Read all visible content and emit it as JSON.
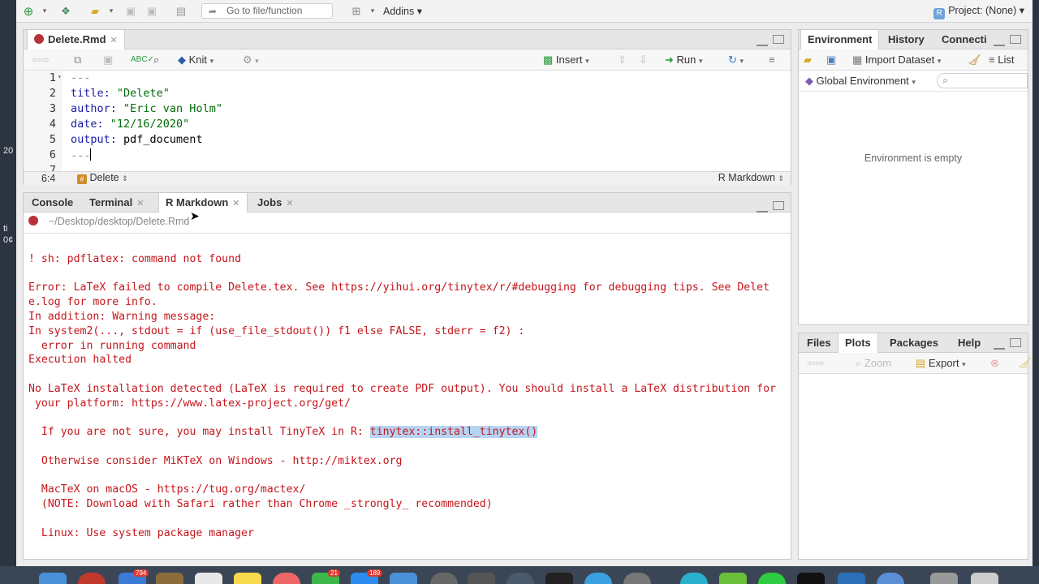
{
  "desktop": {
    "left_labels": [
      "20",
      "ti",
      "0¢"
    ],
    "dock_badges": [
      "794",
      "21",
      "189"
    ]
  },
  "toolbar": {
    "goto_placeholder": "Go to file/function",
    "addins_label": "Addins",
    "project_label": "Project: (None)"
  },
  "source": {
    "tab_label": "Delete.Rmd",
    "knit_label": "Knit",
    "insert_label": "Insert",
    "run_label": "Run",
    "lines": [
      {
        "n": "1",
        "text": "---"
      },
      {
        "n": "2",
        "key": "title:",
        "val": " \"Delete\""
      },
      {
        "n": "3",
        "key": "author:",
        "val": " \"Eric van Holm\""
      },
      {
        "n": "4",
        "key": "date:",
        "val": " \"12/16/2020\""
      },
      {
        "n": "5",
        "key": "output:",
        "plain": " pdf_document"
      },
      {
        "n": "6",
        "text": "---"
      },
      {
        "n": "7",
        "text": ""
      }
    ],
    "cursor_pos": "6:4",
    "chunk_label": "Delete",
    "file_type": "R Markdown"
  },
  "console_pane": {
    "tabs": [
      "Console",
      "Terminal",
      "R Markdown",
      "Jobs"
    ],
    "active_tab": "R Markdown",
    "path": "~/Desktop/desktop/Delete.Rmd",
    "output": [
      "! sh: pdflatex: command not found",
      "",
      "Error: LaTeX failed to compile Delete.tex. See https://yihui.org/tinytex/r/#debugging for debugging tips. See Delet",
      "e.log for more info.",
      "In addition: Warning message:",
      "In system2(..., stdout = if (use_file_stdout()) f1 else FALSE, stderr = f2) :",
      "  error in running command",
      "Execution halted",
      "",
      "No LaTeX installation detected (LaTeX is required to create PDF output). You should install a LaTeX distribution for",
      " your platform: https://www.latex-project.org/get/",
      "",
      "  If you are not sure, you may install TinyTeX in R: ",
      "",
      "  Otherwise consider MiKTeX on Windows - http://miktex.org",
      "",
      "  MacTeX on macOS - https://tug.org/mactex/",
      "  (NOTE: Download with Safari rather than Chrome _strongly_ recommended)",
      "",
      "  Linux: Use system package manager"
    ],
    "highlight": "tinytex::install_tinytex()"
  },
  "env_pane": {
    "tabs": [
      "Environment",
      "History",
      "Connecti"
    ],
    "import_label": "Import Dataset",
    "list_label": "List",
    "scope_label": "Global Environment",
    "empty_text": "Environment is empty"
  },
  "files_pane": {
    "tabs": [
      "Files",
      "Plots",
      "Packages",
      "Help"
    ],
    "active_tab": "Plots",
    "zoom_label": "Zoom",
    "export_label": "Export"
  }
}
